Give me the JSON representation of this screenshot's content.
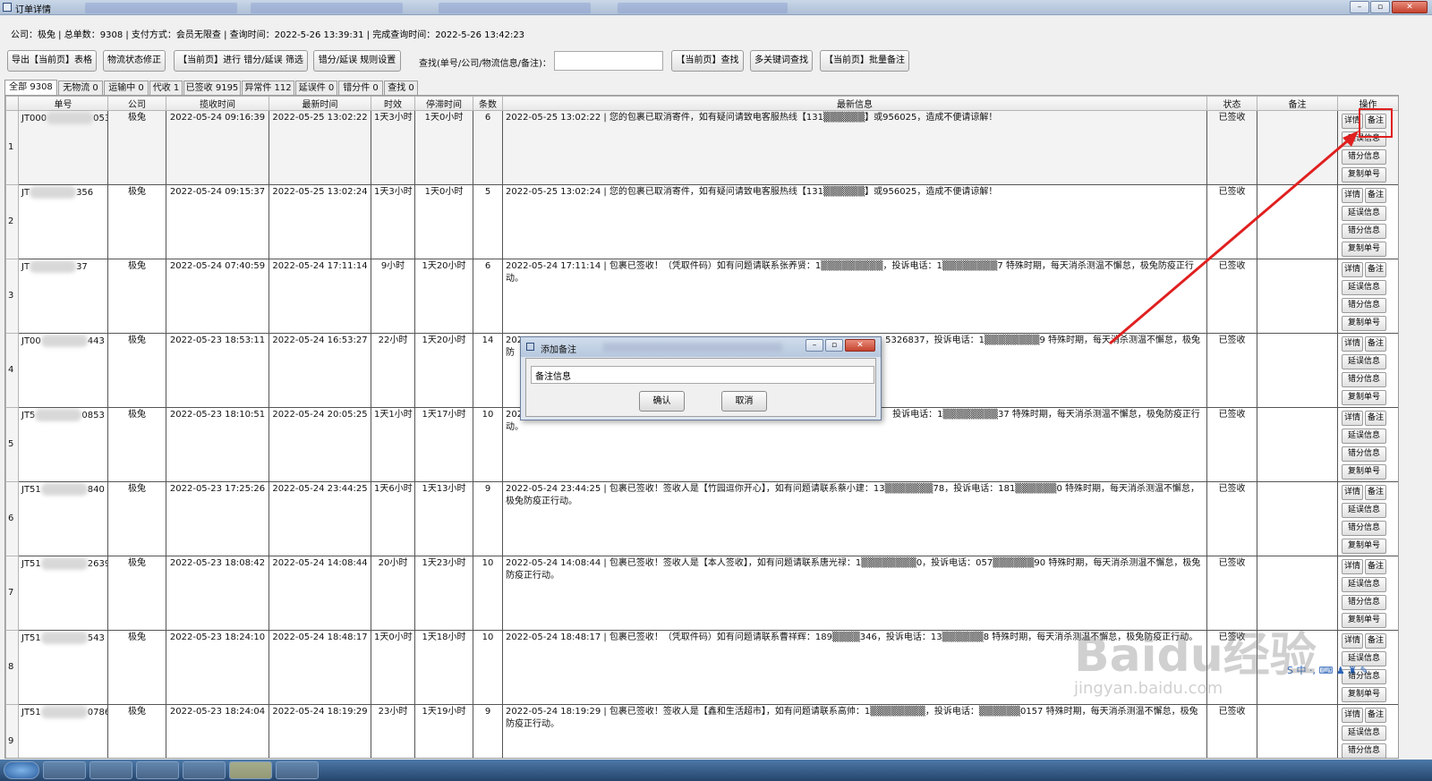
{
  "window": {
    "title": "订单详情",
    "minimize": "–",
    "maximize": "▫",
    "close": "✕"
  },
  "info_line": "公司：极兔 | 总单数：9308 | 支付方式：会员无限查 | 查询时间：2022-5-26 13:39:31 | 完成查询时间：2022-5-26 13:42:23",
  "toolbar": {
    "export": "导出【当前页】表格",
    "fix_status": "物流状态修正",
    "filter": "【当前页】进行 错分/延误 筛选",
    "rule_settings": "错分/延误 规则设置",
    "search_label": "查找(单号/公司/物流信息/备注)：",
    "search_value": "",
    "find_current": "【当前页】查找",
    "multi_keyword": "多关键词查找",
    "batch_remark": "【当前页】批量备注"
  },
  "tabs": [
    "全部 9308",
    "无物流 0",
    "运输中 0",
    "代收 1",
    "已签收 9195",
    "异常件 112",
    "延误件 0",
    "错分件 0",
    "查找 0"
  ],
  "columns": [
    "单号",
    "公司",
    "揽收时间",
    "最新时间",
    "时效",
    "停滞时间",
    "条数",
    "最新信息",
    "状态",
    "备注",
    "操作"
  ],
  "row_buttons": {
    "detail": "详情",
    "remark": "备注",
    "delay": "延误信息",
    "missort": "错分信息",
    "copy": "复制单号"
  },
  "rows": [
    {
      "idx": "1",
      "no_pre": "JT000",
      "no_suf": "053",
      "company": "极兔",
      "pickup": "2022-05-24 09:16:39",
      "latest": "2022-05-25 13:02:22",
      "aging": "1天3小时",
      "stagnant": "1天0小时",
      "count": "6",
      "msg": "2022-05-25 13:02:22 | 您的包裹已取消寄件，如有疑问请致电客服热线【131▒▒▒▒▒▒】或956025，造成不便请谅解！",
      "status": "已签收",
      "remark": ""
    },
    {
      "idx": "2",
      "no_pre": "JT",
      "no_suf": "356",
      "company": "极兔",
      "pickup": "2022-05-24 09:15:37",
      "latest": "2022-05-25 13:02:24",
      "aging": "1天3小时",
      "stagnant": "1天0小时",
      "count": "5",
      "msg": "2022-05-25 13:02:24 | 您的包裹已取消寄件，如有疑问请致电客服热线【131▒▒▒▒▒▒】或956025，造成不便请谅解！",
      "status": "已签收",
      "remark": ""
    },
    {
      "idx": "3",
      "no_pre": "JT",
      "no_suf": "37",
      "company": "极兔",
      "pickup": "2022-05-24 07:40:59",
      "latest": "2022-05-24 17:11:14",
      "aging": "9小时",
      "stagnant": "1天20小时",
      "count": "6",
      "msg": "2022-05-24 17:11:14 | 包裹已签收！（凭取件码）如有问题请联系张养贤：1▒▒▒▒▒▒▒▒▒，投诉电话：1▒▒▒▒▒▒▒▒7 特殊时期，每天消杀测温不懈怠，极兔防疫正行动。",
      "status": "已签收",
      "remark": ""
    },
    {
      "idx": "4",
      "no_pre": "JT00",
      "no_suf": "443",
      "company": "极兔",
      "pickup": "2022-05-23 18:53:11",
      "latest": "2022-05-24 16:53:27",
      "aging": "22小时",
      "stagnant": "1天20小时",
      "count": "14",
      "msg": "202",
      "msg_right": "5326837，投诉电话：1▒▒▒▒▒▒▒▒9 特殊时期，每天消杀测温不懈怠，极兔防",
      "status": "已签收",
      "remark": ""
    },
    {
      "idx": "5",
      "no_pre": "JT5",
      "no_suf": "0853",
      "company": "极兔",
      "pickup": "2022-05-23 18:10:51",
      "latest": "2022-05-24 20:05:25",
      "aging": "1天1小时",
      "stagnant": "1天17小时",
      "count": "10",
      "msg": "202",
      "msg_right": "投诉电话：1▒▒▒▒▒▒▒▒37 特殊时期，每天消杀测温不懈怠，极兔防疫正行动。",
      "status": "已签收",
      "remark": ""
    },
    {
      "idx": "6",
      "no_pre": "JT51",
      "no_suf": "840",
      "company": "极兔",
      "pickup": "2022-05-23 17:25:26",
      "latest": "2022-05-24 23:44:25",
      "aging": "1天6小时",
      "stagnant": "1天13小时",
      "count": "9",
      "msg": "2022-05-24 23:44:25 | 包裹已签收！签收人是【竹园逗你开心】，如有问题请联系蔡小建：13▒▒▒▒▒▒▒78，投诉电话：181▒▒▒▒▒▒0 特殊时期，每天消杀测温不懈怠，极兔防疫正行动。",
      "status": "已签收",
      "remark": ""
    },
    {
      "idx": "7",
      "no_pre": "JT51",
      "no_suf": "2639",
      "company": "极兔",
      "pickup": "2022-05-23 18:08:42",
      "latest": "2022-05-24 14:08:44",
      "aging": "20小时",
      "stagnant": "1天23小时",
      "count": "10",
      "msg": "2022-05-24 14:08:44 | 包裹已签收！签收人是【本人签收】，如有问题请联系唐光禄：1▒▒▒▒▒▒▒▒0，投诉电话：057▒▒▒▒▒▒90 特殊时期，每天消杀测温不懈怠，极兔防疫正行动。",
      "status": "已签收",
      "remark": ""
    },
    {
      "idx": "8",
      "no_pre": "JT51",
      "no_suf": "543",
      "company": "极兔",
      "pickup": "2022-05-23 18:24:10",
      "latest": "2022-05-24 18:48:17",
      "aging": "1天0小时",
      "stagnant": "1天18小时",
      "count": "10",
      "msg": "2022-05-24 18:48:17 | 包裹已签收！（凭取件码）如有问题请联系曹祥辉：189▒▒▒▒346，投诉电话：13▒▒▒▒▒▒8 特殊时期，每天消杀测温不懈怠，极兔防疫正行动。",
      "status": "已签收",
      "remark": ""
    },
    {
      "idx": "9",
      "no_pre": "JT51",
      "no_suf": "0786",
      "company": "极兔",
      "pickup": "2022-05-23 18:24:04",
      "latest": "2022-05-24 18:19:29",
      "aging": "23小时",
      "stagnant": "1天19小时",
      "count": "9",
      "msg": "2022-05-24 18:19:29 | 包裹已签收！签收人是【鑫和生活超市】，如有问题请联系高帅：1▒▒▒▒▒▒▒▒，投诉电话：▒▒▒▒▒▒0157 特殊时期，每天消杀测温不懈怠，极兔防疫正行动。",
      "status": "已签收",
      "remark": ""
    }
  ],
  "dialog": {
    "title": "添加备注",
    "input_value": "备注信息",
    "confirm": "确认",
    "cancel": "取消"
  },
  "watermark": {
    "line1": "Baidu经验",
    "line2": "jingyan.baidu.com"
  },
  "colors": {
    "annotation": "#e02020",
    "titlebar": "#b7c8de",
    "taskbar": "#25456c"
  }
}
